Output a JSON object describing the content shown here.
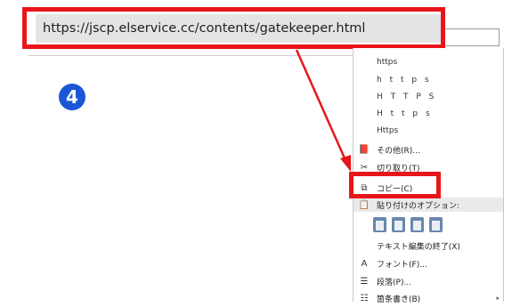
{
  "step_badge": "4",
  "url_bar": {
    "text": "https://jscp.elservice.cc/contents/gatekeeper.html"
  },
  "context_menu": {
    "variants": [
      "https",
      "h t t p s",
      "H T T P S",
      "H t t p s",
      "Https"
    ],
    "other": "その他(R)...",
    "cut": "切り取り(T)",
    "copy": "コピー(C)",
    "paste_options_header": "貼り付けのオプション:",
    "end_text_edit": "テキスト編集の終了(X)",
    "font": "フォント(F)...",
    "paragraph": "段落(P)...",
    "bullets": "箇条書き(B)"
  },
  "colors": {
    "callout": "#e8151b",
    "badge": "#1a56d6",
    "menu_section": "#eaeaea"
  }
}
